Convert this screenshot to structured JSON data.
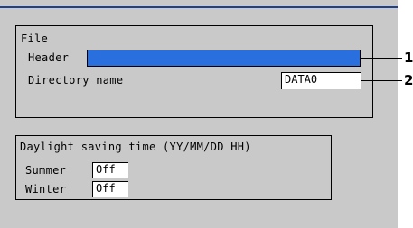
{
  "file_group": {
    "title": "File",
    "header_label": "Header",
    "header_value": "",
    "directory_label": "Directory name",
    "directory_value": "DATA0"
  },
  "dst_group": {
    "title": "Daylight saving time (YY/MM/DD HH)",
    "summer_label": "Summer",
    "summer_value": "Off",
    "winter_label": "Winter",
    "winter_value": "Off"
  },
  "callouts": [
    "1",
    "2"
  ],
  "colors": {
    "screen_bg": "#c9c9c9",
    "selected_field": "#2a6fde",
    "top_line": "#1f3f8f"
  }
}
